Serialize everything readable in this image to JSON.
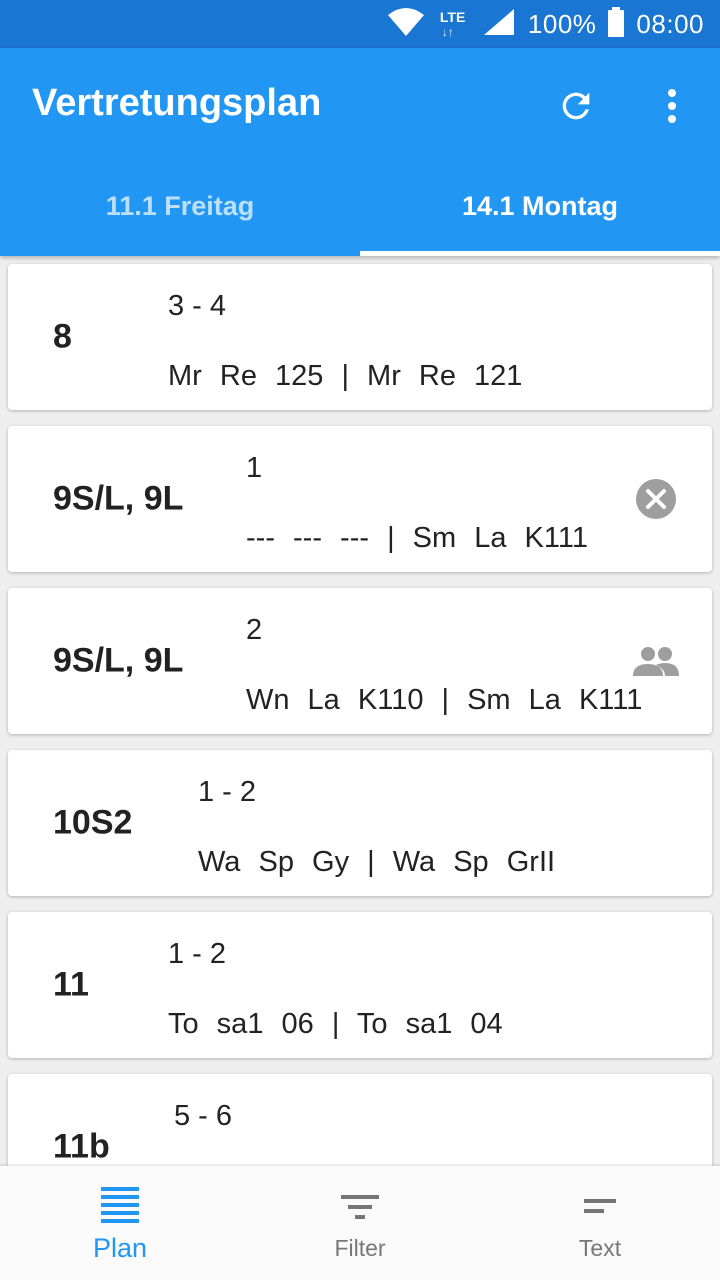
{
  "status_bar": {
    "network": "LTE",
    "battery": "100%",
    "time": "08:00"
  },
  "app_bar": {
    "title": "Vertretungsplan",
    "refresh_icon": "refresh-icon",
    "menu_icon": "more-vert-icon"
  },
  "tabs": [
    {
      "label": "11.1 Freitag",
      "active": false
    },
    {
      "label": "14.1 Montag",
      "active": true
    }
  ],
  "entries": [
    {
      "class": "8",
      "hours": "3 - 4",
      "detail": "Mr  Re  125  |  Mr  Re  121",
      "icon": ""
    },
    {
      "class": "9S/L, 9L",
      "hours": "1",
      "detail": "---  ---  ---  |  Sm  La  K111",
      "icon": "cancel-icon"
    },
    {
      "class": "9S/L, 9L",
      "hours": "2",
      "detail": "Wn  La  K110  |  Sm  La  K111",
      "icon": "group-icon"
    },
    {
      "class": "10S2",
      "hours": "1 - 2",
      "detail": "Wa  Sp  Gy  |  Wa  Sp  GrII",
      "icon": ""
    },
    {
      "class": "11",
      "hours": "1 - 2",
      "detail": "To  sa1  06  |  To  sa1  04",
      "icon": ""
    },
    {
      "class": "11b",
      "hours": "5 - 6",
      "detail": "",
      "icon": ""
    }
  ],
  "bottom_nav": [
    {
      "label": "Plan",
      "icon": "list-icon",
      "active": true
    },
    {
      "label": "Filter",
      "icon": "filter-icon",
      "active": false
    },
    {
      "label": "Text",
      "icon": "short-text-icon",
      "active": false
    }
  ],
  "colors": {
    "primary": "#2196F3",
    "primary_dark": "#1976D2",
    "icon_gray": "#9e9e9e"
  }
}
